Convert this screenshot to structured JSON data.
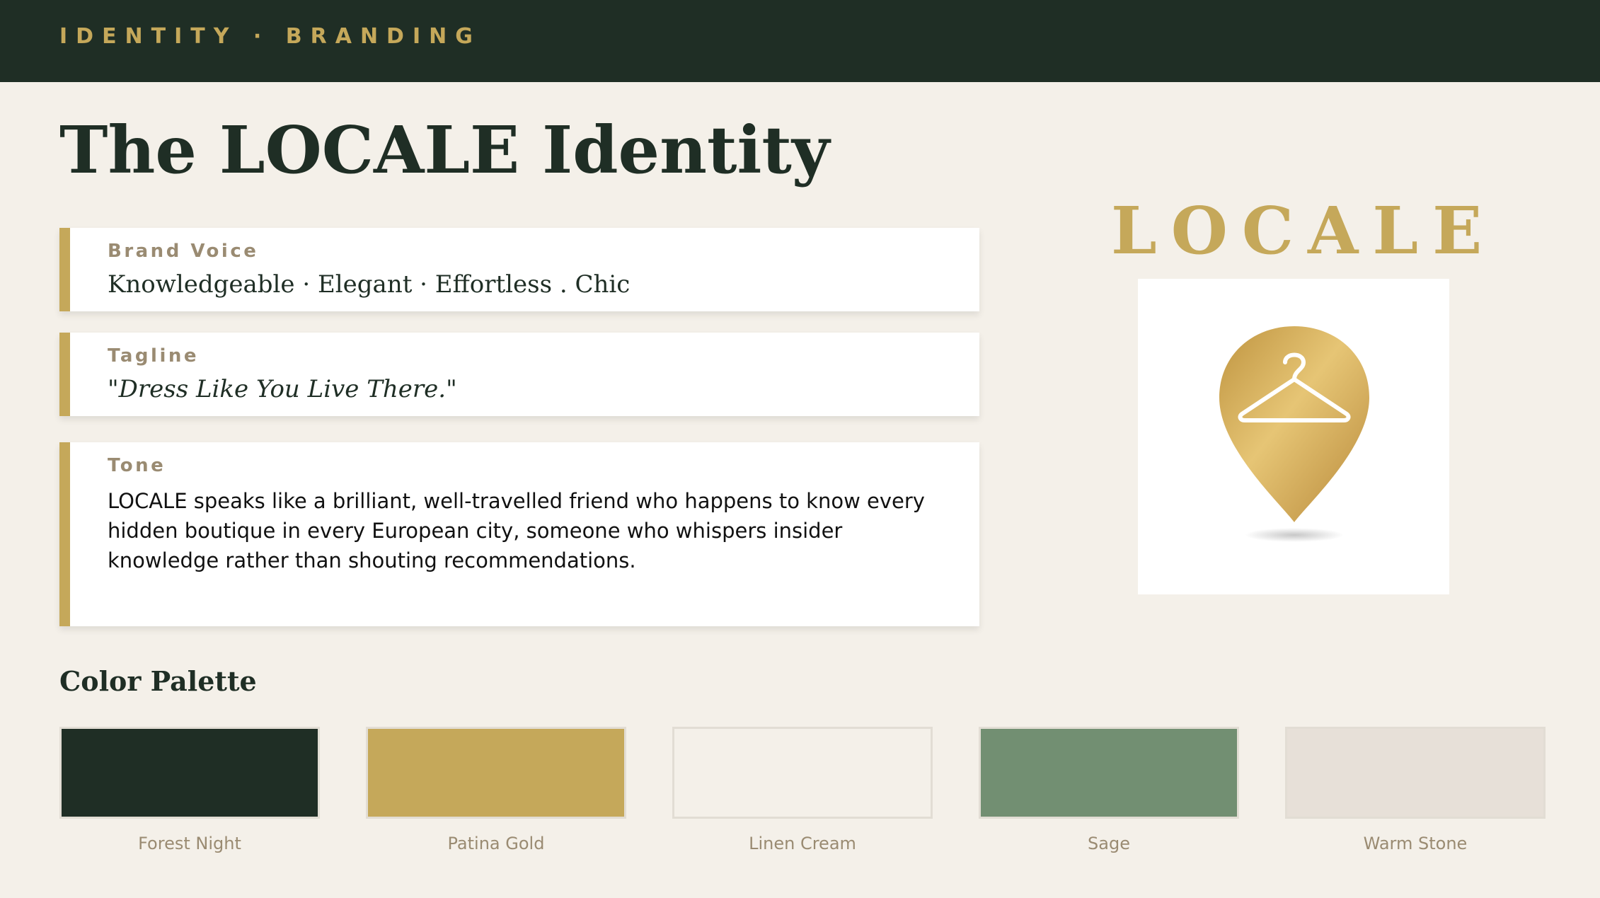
{
  "header": {
    "breadcrumb": "IDENTITY · BRANDING"
  },
  "page": {
    "title": "The LOCALE Identity"
  },
  "cards": [
    {
      "label": "Brand Voice",
      "text": "Knowledgeable · Elegant · Effortless . Chic"
    },
    {
      "label": "Tagline",
      "text": "\"Dress Like You Live There.\""
    },
    {
      "label": "Tone",
      "text": "LOCALE speaks like a brilliant, well-travelled friend who happens to know every hidden boutique in every European city, someone who whispers insider knowledge rather than shouting recommendations."
    }
  ],
  "logo": {
    "wordmark": "LOCALE",
    "icon": "location-pin-hanger-icon"
  },
  "palette": {
    "title": "Color Palette",
    "colors": [
      {
        "name": "Forest Night",
        "hex": "#1F2E25"
      },
      {
        "name": "Patina Gold",
        "hex": "#C5A85A"
      },
      {
        "name": "Linen Cream",
        "hex": "#F4F0E9"
      },
      {
        "name": "Sage",
        "hex": "#728F72"
      },
      {
        "name": "Warm Stone",
        "hex": "#E7E0D8"
      }
    ]
  },
  "theme": {
    "accent": "#C5A85A",
    "dark": "#1F2E25",
    "background": "#F4F0E9",
    "muted_text": "#9A8B72"
  }
}
